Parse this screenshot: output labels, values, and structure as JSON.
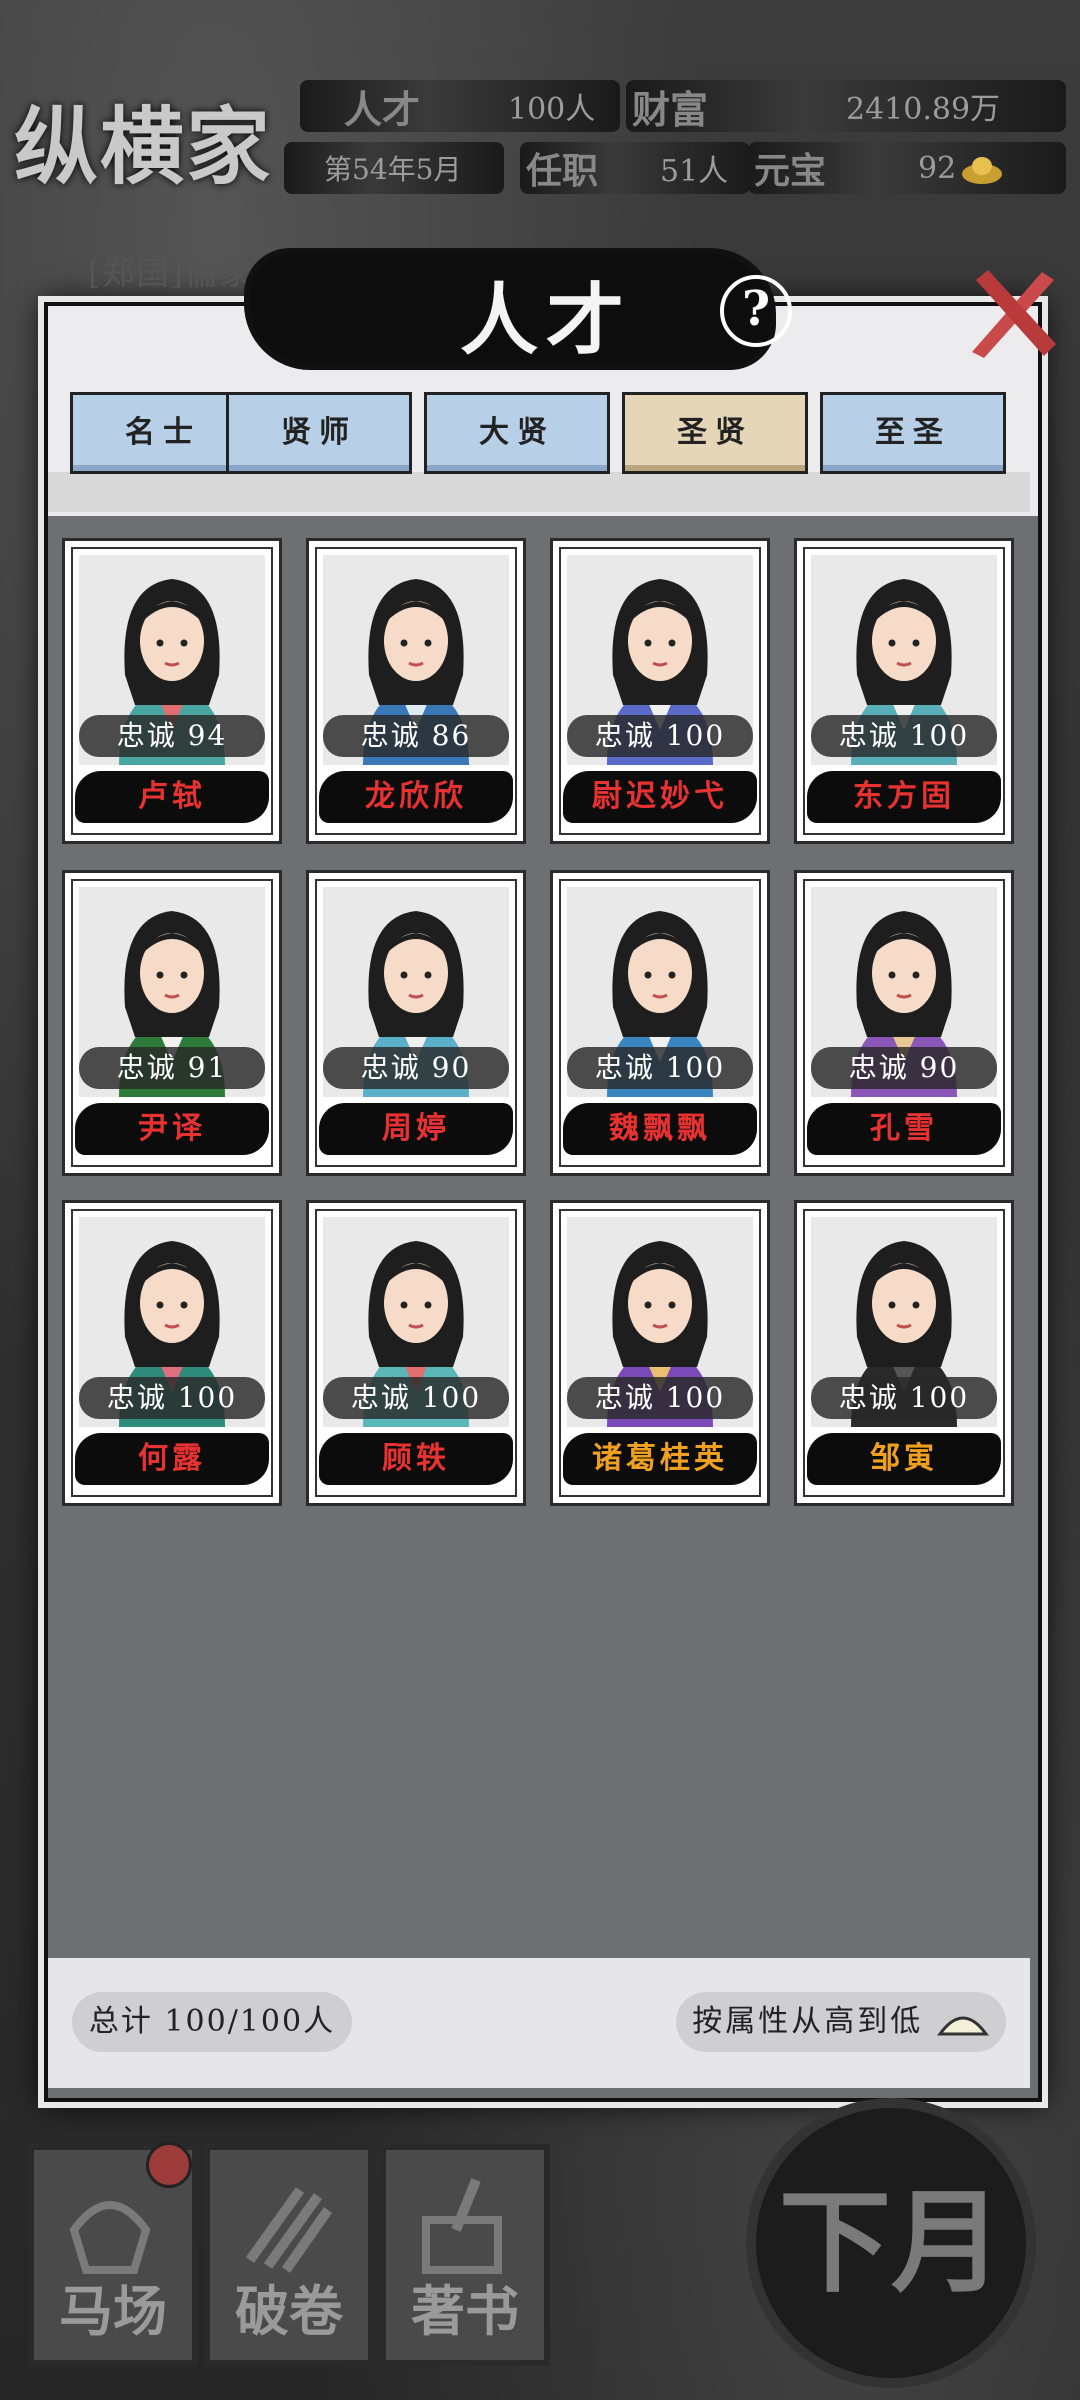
{
  "hud": {
    "sect_name": "纵横家",
    "talent_label": "人才",
    "talent_value": "100人",
    "wealth_label": "财富",
    "wealth_value": "2410.89万",
    "date": "第54年5月",
    "office_label": "任职",
    "office_value": "51人",
    "yuanbao_label": "元宝",
    "yuanbao_value": "92"
  },
  "notice": "[郑国]儒家接                  成功，纵横家影",
  "dialog": {
    "title": "人才",
    "help_icon": "question-icon",
    "close_icon": "close-brush-icon"
  },
  "tabs": [
    {
      "label": "名士",
      "active": false
    },
    {
      "label": "贤师",
      "active": false
    },
    {
      "label": "大贤",
      "active": false
    },
    {
      "label": "圣贤",
      "active": true
    },
    {
      "label": "至圣",
      "active": false
    }
  ],
  "talents": [
    {
      "loyalty": "忠诚 94",
      "name": "卢轼",
      "name_color": "red",
      "robe": "#4aa6a0",
      "accent": "#e07070"
    },
    {
      "loyalty": "忠诚 86",
      "name": "龙欣欣",
      "name_color": "red",
      "robe": "#3a78b8",
      "accent": "#e0ecf4"
    },
    {
      "loyalty": "忠诚 100",
      "name": "尉迟妙弋",
      "name_color": "red",
      "robe": "#5a6ac8",
      "accent": "#f0f0f0"
    },
    {
      "loyalty": "忠诚 100",
      "name": "东方固",
      "name_color": "red",
      "robe": "#5aaeb8",
      "accent": "#f0f0f0"
    },
    {
      "loyalty": "忠诚 91",
      "name": "尹译",
      "name_color": "red",
      "robe": "#2e7a3a",
      "accent": "#f0f0f0"
    },
    {
      "loyalty": "忠诚 90",
      "name": "周婷",
      "name_color": "red",
      "robe": "#5ab0c8",
      "accent": "#f0f0f0"
    },
    {
      "loyalty": "忠诚 100",
      "name": "魏飘飘",
      "name_color": "red",
      "robe": "#3a86c0",
      "accent": "#f0f0f0"
    },
    {
      "loyalty": "忠诚 90",
      "name": "孔雪",
      "name_color": "red",
      "robe": "#8a56b8",
      "accent": "#e8c890"
    },
    {
      "loyalty": "忠诚 100",
      "name": "何露",
      "name_color": "red",
      "robe": "#2e8a7a",
      "accent": "#e07080"
    },
    {
      "loyalty": "忠诚 100",
      "name": "顾轶",
      "name_color": "red",
      "robe": "#5ab8b8",
      "accent": "#e07070"
    },
    {
      "loyalty": "忠诚 100",
      "name": "诸葛桂英",
      "name_color": "gold",
      "robe": "#7a4ab8",
      "accent": "#e8c070"
    },
    {
      "loyalty": "忠诚 100",
      "name": "邹寅",
      "name_color": "gold",
      "robe": "#2a2a2a",
      "accent": "#555555"
    }
  ],
  "footer": {
    "total": "总计  100/100人",
    "sort": "按属性从高到低"
  },
  "bottom_nav": [
    {
      "label": "马场",
      "icon": "horse-saddle-icon"
    },
    {
      "label": "破卷",
      "icon": "bamboo-scroll-icon"
    },
    {
      "label": "著书",
      "icon": "brush-book-icon"
    }
  ],
  "next_month": "下月"
}
